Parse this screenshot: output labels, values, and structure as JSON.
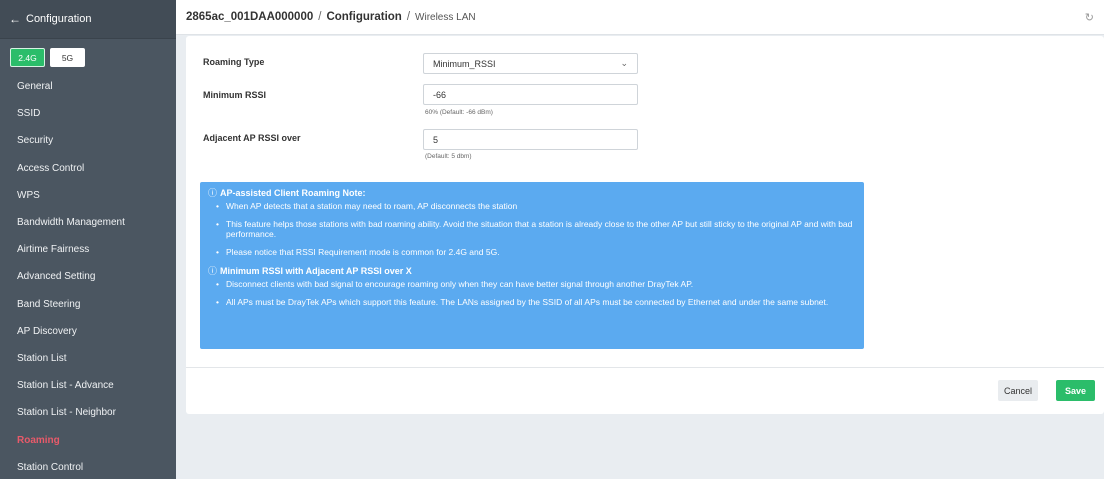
{
  "sidebar": {
    "back_label": "Configuration",
    "bands": [
      {
        "label": "2.4G",
        "active": true
      },
      {
        "label": "5G",
        "active": false
      }
    ],
    "items": [
      {
        "label": "General"
      },
      {
        "label": "SSID"
      },
      {
        "label": "Security"
      },
      {
        "label": "Access Control"
      },
      {
        "label": "WPS"
      },
      {
        "label": "Bandwidth Management"
      },
      {
        "label": "Airtime Fairness"
      },
      {
        "label": "Advanced Setting"
      },
      {
        "label": "Band Steering"
      },
      {
        "label": "AP Discovery"
      },
      {
        "label": "Station List"
      },
      {
        "label": "Station List - Advance"
      },
      {
        "label": "Station List - Neighbor"
      },
      {
        "label": "Roaming",
        "active": true
      },
      {
        "label": "Station Control"
      }
    ]
  },
  "header": {
    "device": "2865ac_001DAA000000",
    "section": "Configuration",
    "page": "Wireless LAN"
  },
  "form": {
    "roaming_type": {
      "label": "Roaming Type",
      "value": "Minimum_RSSI"
    },
    "min_rssi": {
      "label": "Minimum RSSI",
      "value": "-66",
      "hint": "60% (Default: -66 dBm)"
    },
    "adjacent": {
      "label": "Adjacent AP RSSI over",
      "value": "5",
      "hint": "(Default: 5 dbm)"
    }
  },
  "note": {
    "heading1": "AP-assisted Client Roaming Note:",
    "bullets1": [
      "When AP detects that a station may need to roam, AP disconnects the station",
      "This feature helps those stations with bad roaming ability. Avoid the situation that a station is already close to the other AP but still sticky to the original AP and with bad performance.",
      "Please notice that RSSI Requirement mode is common for 2.4G and 5G."
    ],
    "heading2": "Minimum RSSI with Adjacent AP RSSI over X",
    "bullets2": [
      "Disconnect clients with bad signal to encourage roaming only when they can have better signal through another DrayTek AP.",
      "All APs must be DrayTek APs which support this feature. The LANs assigned by the SSID of all APs must be connected by Ethernet and under the same subnet."
    ]
  },
  "actions": {
    "cancel": "Cancel",
    "save": "Save"
  },
  "colors": {
    "accent_green": "#2bbd6a",
    "note_blue": "#5baaf0",
    "active_red": "#e85a6a",
    "sidebar_bg": "#4b5661"
  }
}
